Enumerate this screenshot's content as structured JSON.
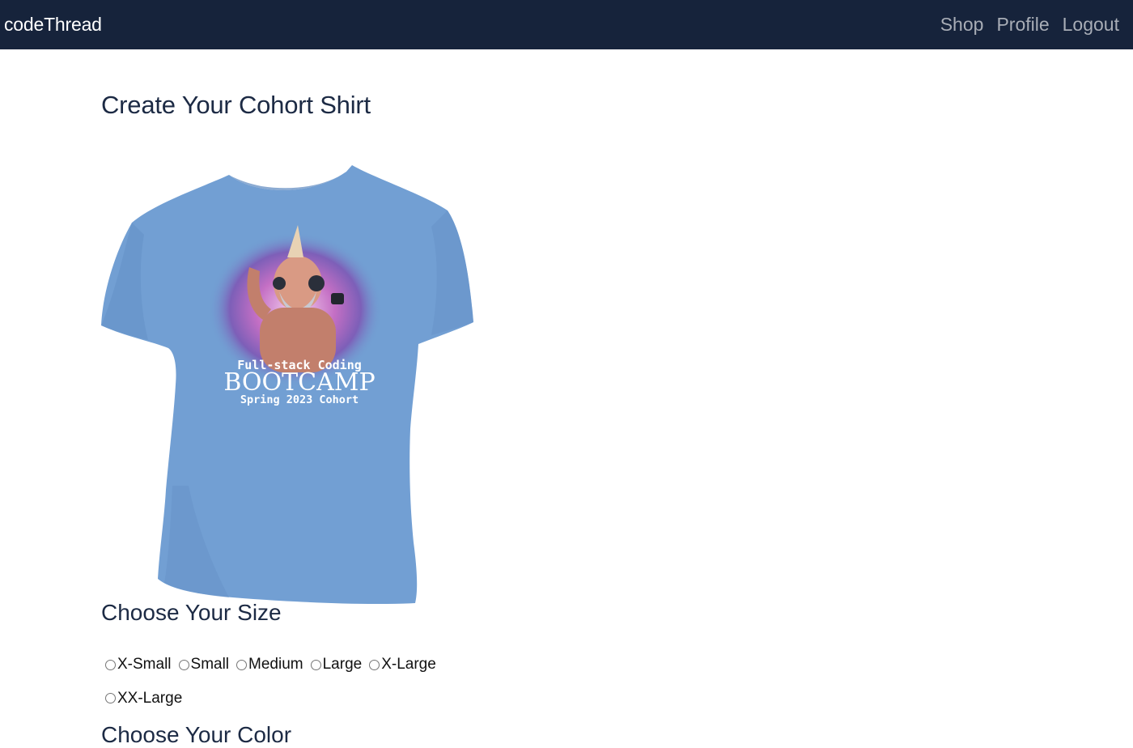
{
  "navbar": {
    "brand": "codeThread",
    "links": [
      {
        "label": "Shop"
      },
      {
        "label": "Profile"
      },
      {
        "label": "Logout"
      }
    ]
  },
  "page": {
    "title": "Create Your Cohort Shirt"
  },
  "shirt": {
    "color": "#729fd3",
    "print_line1": "Full-stack Coding",
    "print_line2": "BOOTCAMP",
    "print_line3": "Spring 2023 Cohort"
  },
  "size_section": {
    "title": "Choose Your Size",
    "options": [
      "X-Small",
      "Small",
      "Medium",
      "Large",
      "X-Large",
      "XX-Large"
    ]
  },
  "color_section": {
    "title": "Choose Your Color"
  }
}
